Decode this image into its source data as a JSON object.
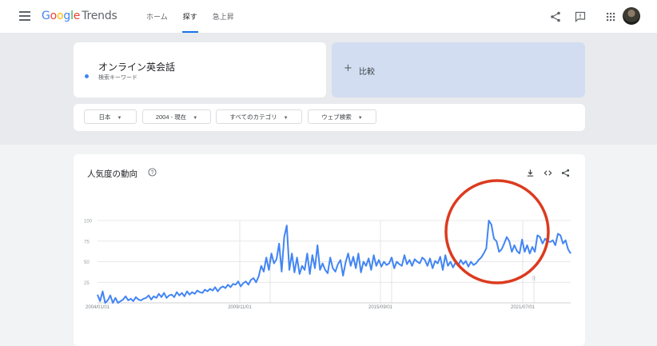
{
  "header": {
    "logo_google": "Google",
    "logo_trends": "Trends",
    "nav": [
      {
        "label": "ホーム",
        "active": false
      },
      {
        "label": "探す",
        "active": true
      },
      {
        "label": "急上昇",
        "active": false
      }
    ],
    "icons": [
      "menu-icon",
      "share-icon",
      "feedback-icon",
      "apps-icon",
      "avatar"
    ]
  },
  "search": {
    "term": "オンライン英会話",
    "term_type": "検索キーワード",
    "term_color": "#4285f4",
    "compare_plus": "+",
    "compare_label": "比較"
  },
  "filters": [
    {
      "label": "日本"
    },
    {
      "label": "2004 - 現在"
    },
    {
      "label": "すべてのカテゴリ"
    },
    {
      "label": "ウェブ検索"
    }
  ],
  "chart_card": {
    "title": "人気度の動向",
    "icons": [
      "help-icon",
      "download-icon",
      "embed-icon",
      "share-icon"
    ]
  },
  "chart_data": {
    "type": "line",
    "title": "",
    "xlabel": "",
    "ylabel": "",
    "ylim": [
      0,
      100
    ],
    "y_ticks": [
      "100",
      "75",
      "50",
      "25"
    ],
    "x_ticks": [
      "2004/01/01",
      "2009/11/01",
      "2015/09/01",
      "2021/07/01"
    ],
    "annotation_markers": [
      "注",
      "注",
      "注"
    ],
    "grid": true,
    "series_color": "#4285f4",
    "annotation": {
      "shape": "circle",
      "color": "#dc3b1f"
    },
    "series": [
      {
        "name": "オンライン英会話",
        "x_start": "2004-01",
        "x_end": "2023-12",
        "values": [
          10,
          2,
          14,
          0,
          3,
          9,
          0,
          6,
          0,
          2,
          4,
          8,
          3,
          5,
          2,
          7,
          4,
          3,
          5,
          6,
          9,
          4,
          8,
          6,
          11,
          7,
          12,
          6,
          9,
          10,
          7,
          13,
          9,
          12,
          8,
          14,
          10,
          13,
          11,
          15,
          13,
          12,
          16,
          14,
          17,
          15,
          19,
          14,
          18,
          20,
          18,
          22,
          19,
          23,
          22,
          26,
          20,
          24,
          26,
          22,
          28,
          30,
          25,
          32,
          45,
          38,
          55,
          40,
          60,
          48,
          53,
          72,
          38,
          80,
          94,
          40,
          60,
          37,
          55,
          35,
          45,
          40,
          60,
          35,
          58,
          42,
          70,
          40,
          48,
          40,
          36,
          55,
          42,
          38,
          47,
          52,
          33,
          49,
          60,
          45,
          56,
          42,
          60,
          37,
          50,
          45,
          54,
          40,
          58,
          45,
          52,
          44,
          50,
          46,
          48,
          55,
          42,
          50,
          47,
          45,
          58,
          47,
          52,
          45,
          53,
          50,
          48,
          55,
          52,
          45,
          54,
          42,
          51,
          48,
          56,
          40,
          58,
          45,
          50,
          43,
          49,
          45,
          52,
          47,
          51,
          44,
          50,
          46,
          48,
          52,
          55,
          60,
          66,
          100,
          95,
          78,
          75,
          62,
          65,
          72,
          80,
          75,
          62,
          70,
          63,
          60,
          77,
          62,
          70,
          60,
          68,
          62,
          82,
          80,
          72,
          78,
          75,
          74,
          76,
          70,
          84,
          82,
          72,
          76,
          65,
          60
        ]
      }
    ]
  }
}
